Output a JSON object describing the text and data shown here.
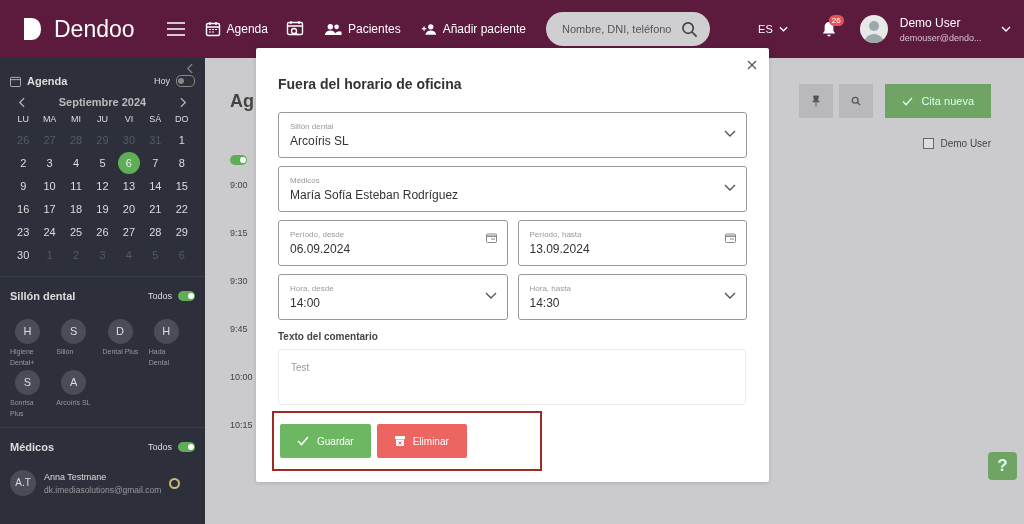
{
  "header": {
    "logo": "Dendoo",
    "nav": [
      "Agenda",
      "Pacientes",
      "Añadir paciente"
    ],
    "search_placeholder": "Nombre, DNI, teléfono",
    "language": "ES",
    "notifications": "26",
    "user_name": "Demo User",
    "user_email": "demouser@dendo..."
  },
  "sidebar": {
    "agenda_title": "Agenda",
    "today_label": "Hoy",
    "today_on": false,
    "month": "Septiembre 2024",
    "weekdays": [
      "LU",
      "MA",
      "MI",
      "JU",
      "VI",
      "SÁ",
      "DO"
    ],
    "days": [
      {
        "label": "26",
        "muted": true,
        "selected": false
      },
      {
        "label": "27",
        "muted": true,
        "selected": false
      },
      {
        "label": "28",
        "muted": true,
        "selected": false
      },
      {
        "label": "29",
        "muted": true,
        "selected": false
      },
      {
        "label": "30",
        "muted": true,
        "selected": false
      },
      {
        "label": "31",
        "muted": true,
        "selected": false
      },
      {
        "label": "1",
        "muted": false,
        "selected": false
      },
      {
        "label": "2",
        "muted": false,
        "selected": false
      },
      {
        "label": "3",
        "muted": false,
        "selected": false
      },
      {
        "label": "4",
        "muted": false,
        "selected": false
      },
      {
        "label": "5",
        "muted": false,
        "selected": false
      },
      {
        "label": "6",
        "muted": false,
        "selected": true
      },
      {
        "label": "7",
        "muted": false,
        "selected": false
      },
      {
        "label": "8",
        "muted": false,
        "selected": false
      },
      {
        "label": "9",
        "muted": false,
        "selected": false
      },
      {
        "label": "10",
        "muted": false,
        "selected": false
      },
      {
        "label": "11",
        "muted": false,
        "selected": false
      },
      {
        "label": "12",
        "muted": false,
        "selected": false
      },
      {
        "label": "13",
        "muted": false,
        "selected": false
      },
      {
        "label": "14",
        "muted": false,
        "selected": false
      },
      {
        "label": "15",
        "muted": false,
        "selected": false
      },
      {
        "label": "16",
        "muted": false,
        "selected": false
      },
      {
        "label": "17",
        "muted": false,
        "selected": false
      },
      {
        "label": "18",
        "muted": false,
        "selected": false
      },
      {
        "label": "19",
        "muted": false,
        "selected": false
      },
      {
        "label": "20",
        "muted": false,
        "selected": false
      },
      {
        "label": "21",
        "muted": false,
        "selected": false
      },
      {
        "label": "22",
        "muted": false,
        "selected": false
      },
      {
        "label": "23",
        "muted": false,
        "selected": false
      },
      {
        "label": "24",
        "muted": false,
        "selected": false
      },
      {
        "label": "25",
        "muted": false,
        "selected": false
      },
      {
        "label": "26",
        "muted": false,
        "selected": false
      },
      {
        "label": "27",
        "muted": false,
        "selected": false
      },
      {
        "label": "28",
        "muted": false,
        "selected": false
      },
      {
        "label": "29",
        "muted": false,
        "selected": false
      },
      {
        "label": "30",
        "muted": false,
        "selected": false
      },
      {
        "label": "1",
        "muted": true,
        "selected": false
      },
      {
        "label": "2",
        "muted": true,
        "selected": false
      },
      {
        "label": "3",
        "muted": true,
        "selected": false
      },
      {
        "label": "4",
        "muted": true,
        "selected": false
      },
      {
        "label": "5",
        "muted": true,
        "selected": false
      },
      {
        "label": "6",
        "muted": true,
        "selected": false
      }
    ],
    "chairs_title": "Sillón dental",
    "chairs_all_label": "Todos",
    "chairs_all_on": true,
    "chairs": [
      {
        "initial": "H",
        "name": "Higiene Dental+"
      },
      {
        "initial": "S",
        "name": "Sillón"
      },
      {
        "initial": "D",
        "name": "Dental Plus"
      },
      {
        "initial": "H",
        "name": "Hada Dental"
      },
      {
        "initial": "S",
        "name": "Sonrisa Plus"
      },
      {
        "initial": "A",
        "name": "Arcoíris SL"
      }
    ],
    "doctors_title": "Médicos",
    "doctors_all_label": "Todos",
    "doctors_all_on": true,
    "doctors": [
      {
        "initials": "A.T",
        "name": "Anna Testmane",
        "email": "dk.imediasolutions@gmail.com"
      }
    ]
  },
  "main": {
    "title": "Ag",
    "new_button": "Cita nueva",
    "user_filter": {
      "label": "Demo User",
      "checked": false
    },
    "toggle_on": true,
    "help_button": "?",
    "times": [
      "9:00",
      "9:15",
      "9:30",
      "9:45",
      "10:00",
      "10:15"
    ]
  },
  "dialog": {
    "title": "Fuera del horario de oficina",
    "rows": [
      [
        {
          "kind": "select",
          "label": "Sillón dental",
          "value": "Arcoíris SL"
        }
      ],
      [
        {
          "kind": "select",
          "label": "Médicos",
          "value": "María Sofía Esteban Rodríguez"
        }
      ],
      [
        {
          "kind": "date",
          "label": "Período, desde",
          "value": "06.09.2024"
        },
        {
          "kind": "date",
          "label": "Período, hasta",
          "value": "13.09.2024"
        }
      ],
      [
        {
          "kind": "select",
          "label": "Hora, desde",
          "value": "14:00"
        },
        {
          "kind": "select",
          "label": "Hora, hasta",
          "value": "14:30"
        }
      ]
    ],
    "comment_label": "Texto del comentario",
    "comment_placeholder": "Test",
    "save": "Guardar",
    "delete": "Eliminar"
  }
}
